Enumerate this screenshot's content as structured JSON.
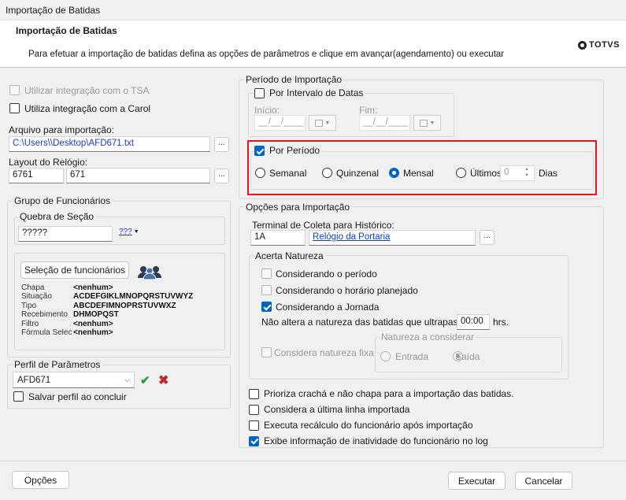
{
  "window": {
    "title": "Importação de Batidas"
  },
  "header": {
    "title": "Importação de Batidas",
    "description": "Para efetuar a importação de batidas defina as opções de parâmetros e clique em avançar(agendamento) ou executar",
    "logo": "TOTVS"
  },
  "left": {
    "tsa_label": "Utilizar integração com o TSA",
    "carol_label": "Utiliza integração com a Carol",
    "arquivo_label": "Arquivo para importação:",
    "arquivo_value": "C:\\Users\\\\Desktop\\AFD671.txt",
    "layout_label": "Layout do Relógio:",
    "layout_code": "6761",
    "layout_name": "671",
    "browse": "..."
  },
  "grupo": {
    "title": "Grupo de Funcionários",
    "quebra_title": "Quebra de Seção",
    "quebra_value": "?????",
    "quebra_btn": "???",
    "selecao_button": "Seleção de funcionários",
    "fields": [
      {
        "label": "Chapa",
        "value": "<nenhum>"
      },
      {
        "label": "Situação",
        "value": "ACDEFGIKLMNOPQRSTUVWYZ"
      },
      {
        "label": "Tipo",
        "value": "ABCDEFIMNOPRSTUVWXZ"
      },
      {
        "label": "Recebimento",
        "value": "DHMOPQST"
      },
      {
        "label": "Filtro",
        "value": "<nenhum>"
      },
      {
        "label": "Fórmula Selec",
        "value": "<nenhum>"
      }
    ]
  },
  "perfil": {
    "title": "Perfil de Parâmetros",
    "value": "AFD671",
    "salvar_label": "Salvar perfil ao concluir"
  },
  "periodo": {
    "title": "Período de Importação",
    "intervalo_label": "Por Intervalo de Datas",
    "inicio_label": "Início:",
    "fim_label": "Fim:",
    "date_placeholder": "__/__/____",
    "por_periodo_label": "Por Período",
    "options": [
      "Semanal",
      "Quinzenal",
      "Mensal",
      "Últimos"
    ],
    "selected": "Mensal",
    "ultimos_value": "0",
    "dias_label": "Dias"
  },
  "opcoes": {
    "title": "Opções para Importação",
    "terminal_label": "Terminal de Coleta para Histórico:",
    "terminal_code": "1A",
    "terminal_name": "Relógio da Portaria",
    "acerta_title": "Acerta Natureza",
    "acerta_items": [
      {
        "label": "Considerando o período",
        "checked": false
      },
      {
        "label": "Considerando o horário planejado",
        "checked": false
      },
      {
        "label": "Considerando a Jornada",
        "checked": true
      }
    ],
    "nao_altera_label": "Não altera a natureza das batidas que ultrapassem",
    "nao_altera_value": "00:00",
    "nao_altera_unit": "hrs.",
    "fixa_label": "Considera natureza fixa",
    "natureza_title": "Natureza a considerar",
    "entrada_label": "Entrada",
    "saida_label": "Saída",
    "checks": [
      {
        "label": "Prioriza crachá e não chapa para a importação das batidas.",
        "checked": false
      },
      {
        "label": "Considera a última linha importada",
        "checked": false
      },
      {
        "label": "Executa recálculo do funcionário após importação",
        "checked": false
      },
      {
        "label": "Exibe informação de inatividade do funcionário no log",
        "checked": true
      }
    ]
  },
  "footer": {
    "opcoes": "Opções",
    "executar": "Executar",
    "cancelar": "Cancelar"
  },
  "colors": {
    "accent": "#0067c0",
    "highlight": "#e2161b",
    "link": "#0b40c4"
  }
}
